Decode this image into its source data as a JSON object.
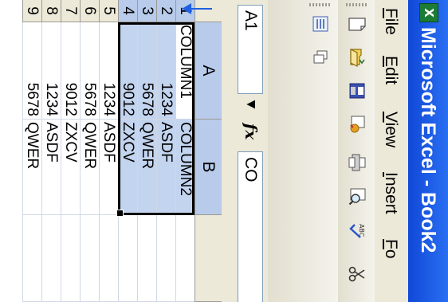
{
  "window": {
    "title": "Microsoft Excel - Book2",
    "app_icon_glyph": "X"
  },
  "menu": [
    {
      "label": "File",
      "accel": "F"
    },
    {
      "label": "Edit",
      "accel": "E"
    },
    {
      "label": "View",
      "accel": "V"
    },
    {
      "label": "Insert",
      "accel": "I"
    },
    {
      "label": "Fo",
      "accel": "F"
    }
  ],
  "toolbar_icons": {
    "standard": [
      "new-icon",
      "open-icon",
      "save-icon",
      "permission-icon",
      "print-icon",
      "print-preview-icon",
      "spelling-icon",
      "cut-icon"
    ],
    "formatting": [
      "options-icon",
      "toolbar-overflow-icon"
    ]
  },
  "formula_bar": {
    "name_box": "A1",
    "fx_label": "fx",
    "content": "CO"
  },
  "columns": [
    "A",
    "B"
  ],
  "rows": [
    "1",
    "2",
    "3",
    "4",
    "5",
    "6",
    "7",
    "8",
    "9"
  ],
  "cells": {
    "1": [
      "COLUMN1",
      "COLUMN2"
    ],
    "2": [
      "1234",
      "ASDF"
    ],
    "3": [
      "5678",
      "QWER"
    ],
    "4": [
      "9012",
      "ZXCV"
    ],
    "5": [
      "1234",
      "ASDF"
    ],
    "6": [
      "5678",
      "QWER"
    ],
    "7": [
      "9012",
      "ZXCV"
    ],
    "8": [
      "1234",
      "ASDF"
    ],
    "9": [
      "5678",
      "QWER"
    ]
  },
  "selection": "A1:B4",
  "colors": {
    "title_bar": "#1048d8",
    "selection_fill": "#c3d4ef",
    "header_highlight": "#b8cbea",
    "annotation_arrow": "#2060e0"
  }
}
